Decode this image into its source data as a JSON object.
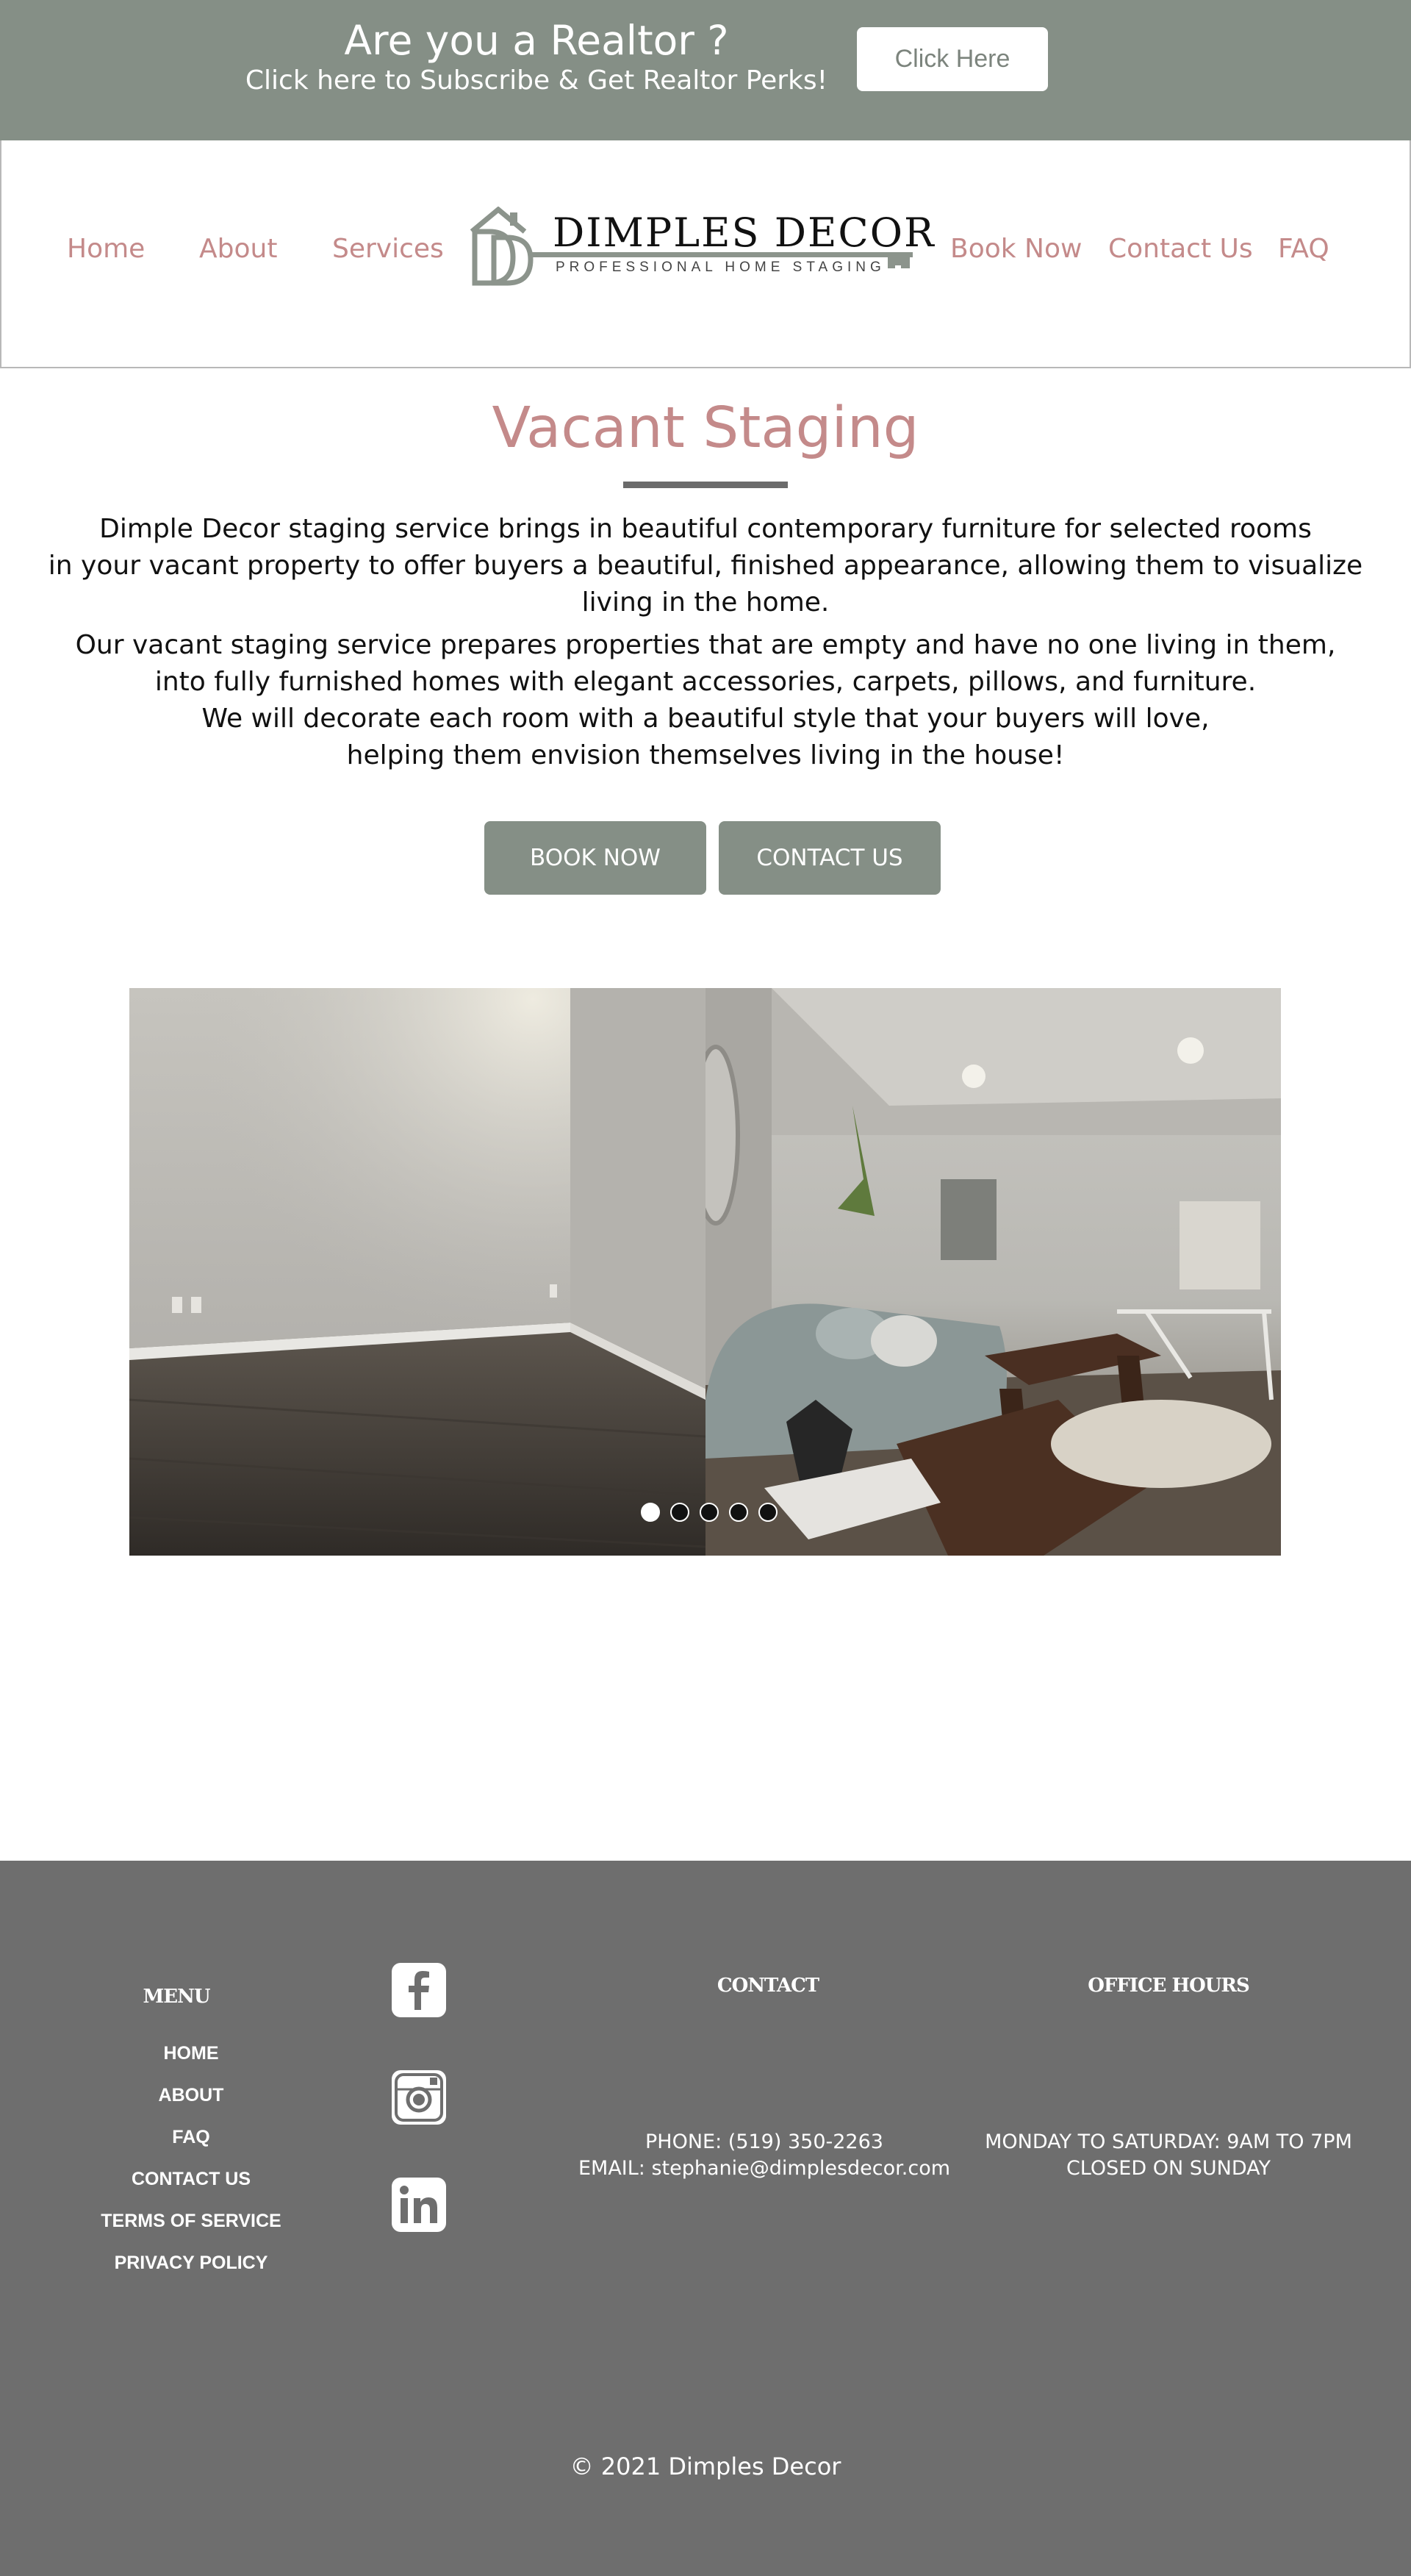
{
  "banner": {
    "title": "Are you a Realtor ?",
    "subtitle": "Click here to Subscribe & Get Realtor Perks!",
    "cta": "Click Here",
    "bg_color": "#858f86"
  },
  "nav": {
    "home": "Home",
    "about": "About",
    "services": "Services",
    "book_now": "Book Now",
    "contact_us": "Contact Us",
    "faq": "FAQ",
    "link_color": "#c48a8a"
  },
  "logo": {
    "name": "DIMPLES DECOR",
    "tagline": "PROFESSIONAL HOME STAGING"
  },
  "main": {
    "title": "Vacant Staging",
    "para1_lines": [
      "Dimple Decor staging service brings in beautiful contemporary furniture for selected rooms",
      "in your vacant property to offer buyers a beautiful, finished appearance, allowing them to visualize",
      "living in the home."
    ],
    "para2_lines": [
      "Our vacant staging service prepares properties that are empty and have no one living in them,",
      "into fully furnished homes with elegant accessories, carpets, pillows, and furniture.",
      "We will decorate each room with a beautiful style that your buyers will love,",
      "helping them envision themselves living in the house!"
    ],
    "book_now_button": "BOOK NOW",
    "contact_us_button": "CONTACT US"
  },
  "slideshow": {
    "slide_count": 5,
    "active_slide": 1
  },
  "footer": {
    "menu_heading": "MENU",
    "menu": [
      "HOME",
      "ABOUT",
      "FAQ",
      "CONTACT US",
      "TERMS OF SERVICE",
      "PRIVACY POLICY"
    ],
    "social_icons": [
      "facebook-icon",
      "instagram-icon",
      "linkedin-icon"
    ],
    "contact_heading": "CONTACT",
    "phone": "PHONE: (519) 350-2263",
    "email": "EMAIL: stephanie@dimplesdecor.com",
    "hours_heading": "OFFICE HOURS",
    "hours_line1": "MONDAY TO SATURDAY: 9AM TO 7PM",
    "hours_line2": "CLOSED ON SUNDAY",
    "copyright": "© 2021 Dimples Decor",
    "bg_color": "#6e6e6e"
  }
}
